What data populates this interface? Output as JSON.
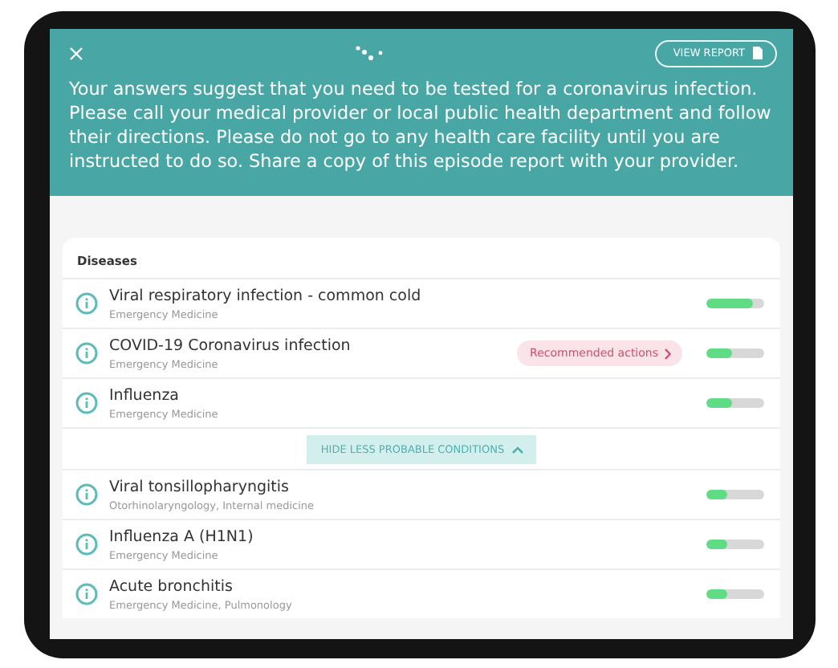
{
  "header": {
    "button": "VIEW REPORT",
    "message": "Your answers suggest that you need to be tested for a coronavirus infection. Please call your medical provider or local public health department and follow their directions. Please do not go to any health care facility until you are instructed to do so.  Share a copy of this episode report with your provider."
  },
  "diseases": {
    "heading": "Diseases",
    "likely": [
      {
        "name": "Viral respiratory infection - common cold",
        "specialty": "Emergency Medicine",
        "level": 0.8
      },
      {
        "name": "COVID-19 Coronavirus infection",
        "specialty": "Emergency Medicine",
        "action": "Recommended actions",
        "level": 0.45
      },
      {
        "name": "Influenza",
        "specialty": "Emergency Medicine",
        "level": 0.45
      }
    ],
    "toggle": "HIDE LESS PROBABLE CONDITIONS",
    "less_probable": [
      {
        "name": "Viral tonsillopharyngitis",
        "specialty": "Otorhinolaryngology, Internal medicine",
        "level": 0.35
      },
      {
        "name": "Influenza A (H1N1)",
        "specialty": "Emergency Medicine",
        "level": 0.35
      },
      {
        "name": "Acute bronchitis",
        "specialty": "Emergency Medicine, Pulmonology",
        "level": 0.35
      }
    ]
  }
}
